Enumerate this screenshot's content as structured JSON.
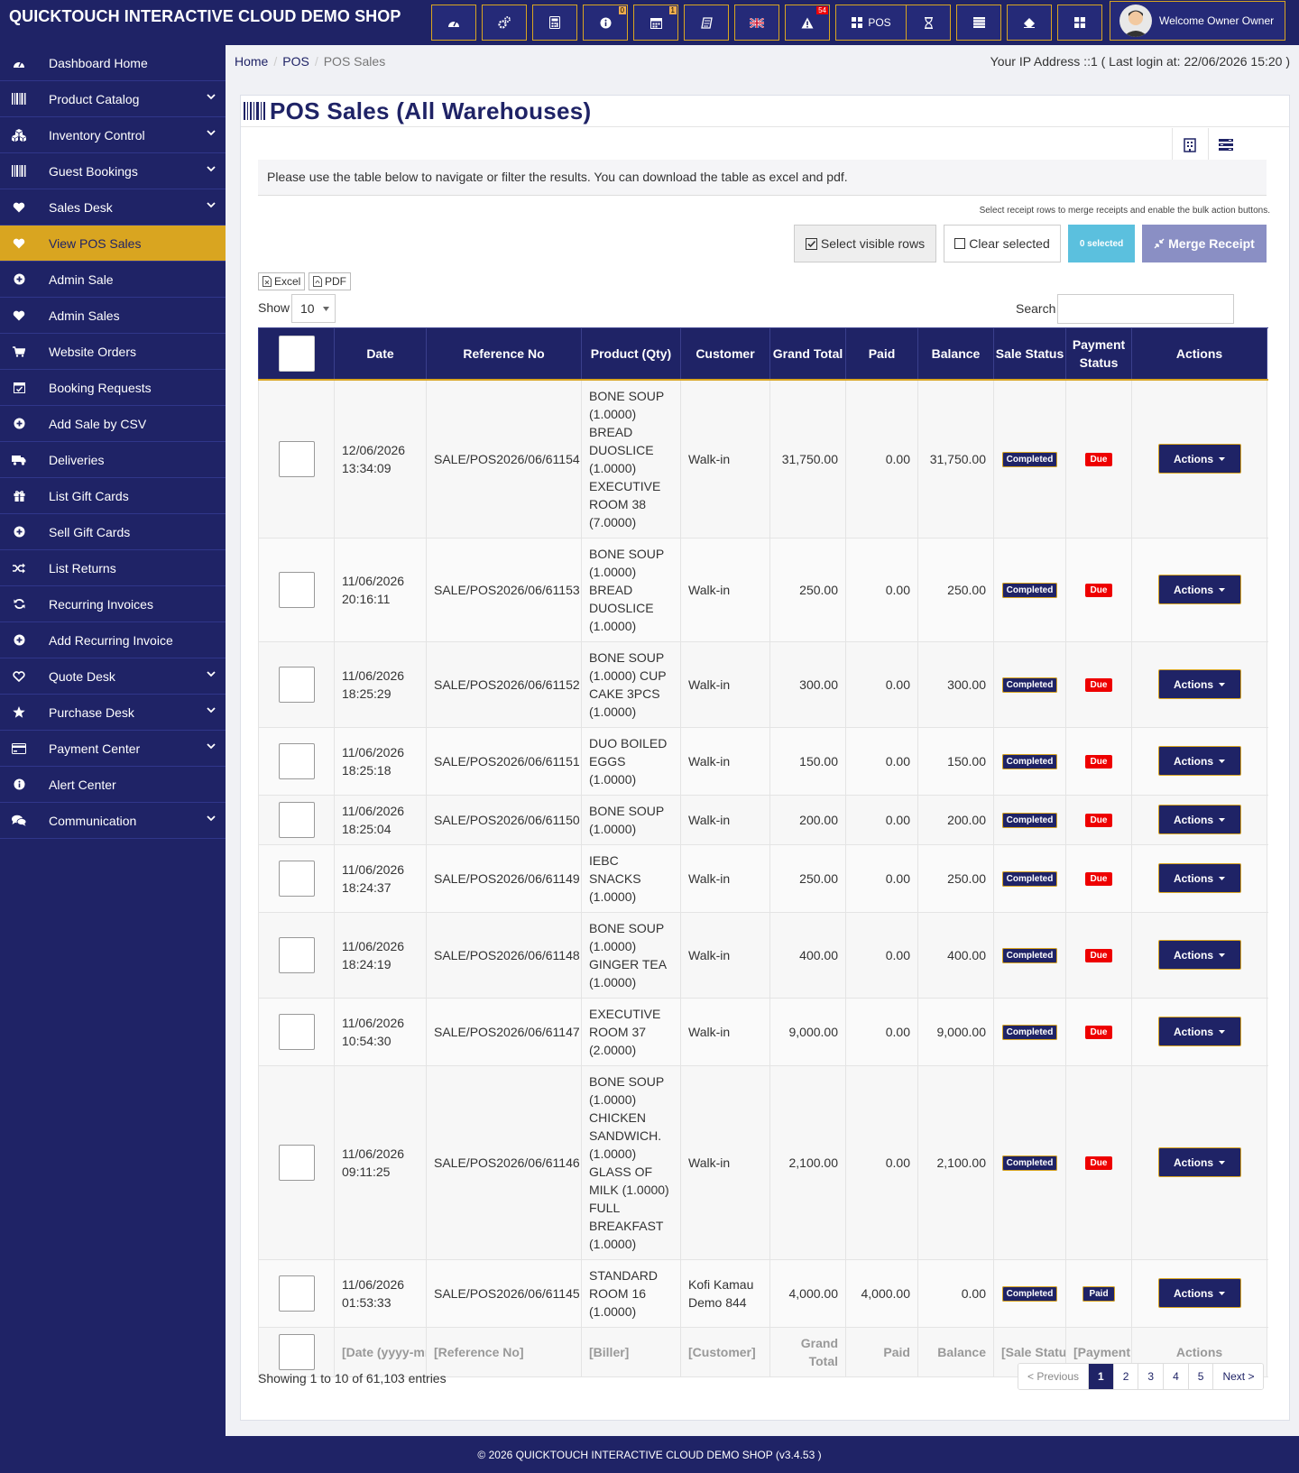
{
  "brand": "QUICKTOUCH INTERACTIVE CLOUD DEMO SHOP",
  "topbar": {
    "buttons": [
      {
        "icon": "dashboard-icon",
        "badge": ""
      },
      {
        "icon": "settings-icon",
        "badge": ""
      },
      {
        "icon": "calculator-icon",
        "badge": ""
      },
      {
        "icon": "info-icon",
        "badge": "0"
      },
      {
        "icon": "calendar-icon",
        "badge": "1"
      },
      {
        "icon": "register-icon",
        "badge": ""
      },
      {
        "icon": "language-flag-icon",
        "badge": ""
      },
      {
        "icon": "alert-icon",
        "badge": "54"
      },
      {
        "icon": "pos-grid-icon",
        "label": "POS"
      },
      {
        "icon": "hourglass-icon",
        "badge": ""
      },
      {
        "icon": "list-icon",
        "badge": ""
      },
      {
        "icon": "eraser-icon",
        "badge": ""
      },
      {
        "icon": "apps-icon",
        "badge": ""
      }
    ],
    "welcome": "Welcome Owner Owner"
  },
  "sidebar": {
    "items": [
      {
        "label": "Dashboard Home",
        "icon": "dashboard-icon",
        "chevron": false
      },
      {
        "label": "Product Catalog",
        "icon": "barcode-icon",
        "chevron": true
      },
      {
        "label": "Inventory Control",
        "icon": "cubes-icon",
        "chevron": true
      },
      {
        "label": "Guest Bookings",
        "icon": "barcode-icon",
        "chevron": true
      },
      {
        "label": "Sales Desk",
        "icon": "heart-icon",
        "chevron": true
      },
      {
        "label": "View POS Sales",
        "icon": "heart-icon",
        "chevron": false,
        "active": true
      },
      {
        "label": "Admin Sale",
        "icon": "plus-circle-icon",
        "chevron": false
      },
      {
        "label": "Admin Sales",
        "icon": "heart-icon",
        "chevron": false
      },
      {
        "label": "Website Orders",
        "icon": "cart-icon",
        "chevron": false
      },
      {
        "label": "Booking Requests",
        "icon": "calendar-check-icon",
        "chevron": false
      },
      {
        "label": "Add Sale by CSV",
        "icon": "plus-circle-icon",
        "chevron": false
      },
      {
        "label": "Deliveries",
        "icon": "truck-icon",
        "chevron": false
      },
      {
        "label": "List Gift Cards",
        "icon": "gift-icon",
        "chevron": false
      },
      {
        "label": "Sell Gift Cards",
        "icon": "plus-circle-icon",
        "chevron": false
      },
      {
        "label": "List Returns",
        "icon": "random-icon",
        "chevron": false
      },
      {
        "label": "Recurring Invoices",
        "icon": "refresh-icon",
        "chevron": false
      },
      {
        "label": "Add Recurring Invoice",
        "icon": "plus-circle-icon",
        "chevron": false
      },
      {
        "label": "Quote Desk",
        "icon": "heart-outline-icon",
        "chevron": true
      },
      {
        "label": "Purchase Desk",
        "icon": "star-icon",
        "chevron": true
      },
      {
        "label": "Payment Center",
        "icon": "credit-card-icon",
        "chevron": true
      },
      {
        "label": "Alert Center",
        "icon": "info-circle-icon",
        "chevron": false
      },
      {
        "label": "Communication",
        "icon": "comments-icon",
        "chevron": true
      }
    ]
  },
  "breadcrumb": {
    "home": "Home",
    "pos": "POS",
    "current": "POS Sales"
  },
  "ip_info": "Your IP Address ::1 ( Last login at: 22/06/2026 15:20 )",
  "page_title": "POS Sales (All Warehouses)",
  "intro": "Please use the table below to navigate or filter the results. You can download the table as excel and pdf.",
  "hint": "Select receipt rows to merge receipts and enable the bulk action buttons.",
  "bulk": {
    "select_visible": "Select visible rows",
    "clear_selected": "Clear selected",
    "selected_count": "0 selected",
    "merge": "Merge Receipt"
  },
  "export": {
    "excel": "Excel",
    "pdf": "PDF"
  },
  "show": {
    "label": "Show",
    "value": "10"
  },
  "search": {
    "label": "Search",
    "value": ""
  },
  "table": {
    "columns": [
      "Date",
      "Reference No",
      "Product (Qty)",
      "Customer",
      "Grand Total",
      "Paid",
      "Balance",
      "Sale Status",
      "Payment Status",
      "Actions"
    ],
    "rows": [
      {
        "date": "12/06/2026 13:34:09",
        "ref": "SALE/POS2026/06/61154",
        "product": "BONE SOUP (1.0000) BREAD DUOSLICE (1.0000) EXECUTIVE ROOM 38 (7.0000)",
        "customer": "Walk-in",
        "total": "31,750.00",
        "paid": "0.00",
        "balance": "31,750.00",
        "sale_status": "Completed",
        "payment_status": "Due",
        "action": "Actions"
      },
      {
        "date": "11/06/2026 20:16:11",
        "ref": "SALE/POS2026/06/61153",
        "product": "BONE SOUP (1.0000) BREAD DUOSLICE (1.0000)",
        "customer": "Walk-in",
        "total": "250.00",
        "paid": "0.00",
        "balance": "250.00",
        "sale_status": "Completed",
        "payment_status": "Due",
        "action": "Actions"
      },
      {
        "date": "11/06/2026 18:25:29",
        "ref": "SALE/POS2026/06/61152",
        "product": "BONE SOUP (1.0000) CUP CAKE 3PCS (1.0000)",
        "customer": "Walk-in",
        "total": "300.00",
        "paid": "0.00",
        "balance": "300.00",
        "sale_status": "Completed",
        "payment_status": "Due",
        "action": "Actions"
      },
      {
        "date": "11/06/2026 18:25:18",
        "ref": "SALE/POS2026/06/61151",
        "product": "DUO BOILED EGGS (1.0000)",
        "customer": "Walk-in",
        "total": "150.00",
        "paid": "0.00",
        "balance": "150.00",
        "sale_status": "Completed",
        "payment_status": "Due",
        "action": "Actions"
      },
      {
        "date": "11/06/2026 18:25:04",
        "ref": "SALE/POS2026/06/61150",
        "product": "BONE SOUP (1.0000)",
        "customer": "Walk-in",
        "total": "200.00",
        "paid": "0.00",
        "balance": "200.00",
        "sale_status": "Completed",
        "payment_status": "Due",
        "action": "Actions"
      },
      {
        "date": "11/06/2026 18:24:37",
        "ref": "SALE/POS2026/06/61149",
        "product": "IEBC SNACKS (1.0000)",
        "customer": "Walk-in",
        "total": "250.00",
        "paid": "0.00",
        "balance": "250.00",
        "sale_status": "Completed",
        "payment_status": "Due",
        "action": "Actions"
      },
      {
        "date": "11/06/2026 18:24:19",
        "ref": "SALE/POS2026/06/61148",
        "product": "BONE SOUP (1.0000) GINGER TEA (1.0000)",
        "customer": "Walk-in",
        "total": "400.00",
        "paid": "0.00",
        "balance": "400.00",
        "sale_status": "Completed",
        "payment_status": "Due",
        "action": "Actions"
      },
      {
        "date": "11/06/2026 10:54:30",
        "ref": "SALE/POS2026/06/61147",
        "product": "EXECUTIVE ROOM 37 (2.0000)",
        "customer": "Walk-in",
        "total": "9,000.00",
        "paid": "0.00",
        "balance": "9,000.00",
        "sale_status": "Completed",
        "payment_status": "Due",
        "action": "Actions"
      },
      {
        "date": "11/06/2026 09:11:25",
        "ref": "SALE/POS2026/06/61146",
        "product": "BONE SOUP (1.0000) CHICKEN SANDWICH. (1.0000) GLASS OF MILK (1.0000) FULL BREAKFAST (1.0000)",
        "customer": "Walk-in",
        "total": "2,100.00",
        "paid": "0.00",
        "balance": "2,100.00",
        "sale_status": "Completed",
        "payment_status": "Due",
        "action": "Actions"
      },
      {
        "date": "11/06/2026 01:53:33",
        "ref": "SALE/POS2026/06/61145",
        "product": "STANDARD ROOM 16 (1.0000)",
        "customer": "Kofi Kamau Demo 844",
        "total": "4,000.00",
        "paid": "4,000.00",
        "balance": "0.00",
        "sale_status": "Completed",
        "payment_status": "Paid",
        "action": "Actions"
      }
    ],
    "footer": [
      "[Date (yyyy-mm-dd)]",
      "[Reference No]",
      "[Biller]",
      "[Customer]",
      "Grand Total",
      "Paid",
      "Balance",
      "[Sale Status]",
      "[Payment Status]",
      "Actions"
    ]
  },
  "showing": "Showing 1 to 10 of 61,103 entries",
  "pagination": {
    "previous": "< Previous",
    "pages": [
      "1",
      "2",
      "3",
      "4",
      "5"
    ],
    "current": "1",
    "next": "Next >"
  },
  "footer": "© 2026 QUICKTOUCH INTERACTIVE CLOUD DEMO SHOP (v3.4.53 )",
  "colors": {
    "primary": "#1f2366",
    "accent": "#d9a520",
    "info": "#5bc0de",
    "danger": "#ee0000"
  }
}
